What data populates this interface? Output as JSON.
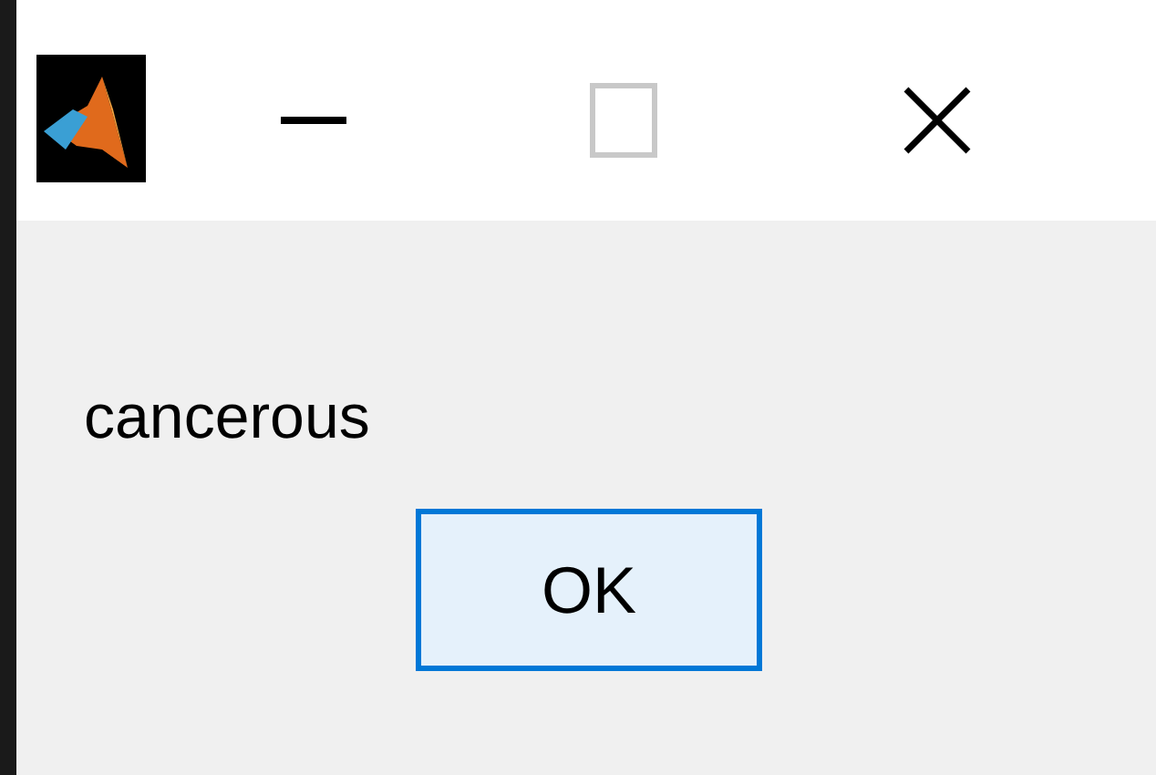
{
  "title_bar": {
    "controls": [
      {
        "kind": "minimize",
        "disabled": false
      },
      {
        "kind": "maximize",
        "disabled": true
      },
      {
        "kind": "close",
        "disabled": false
      }
    ]
  },
  "message": "cancerous",
  "buttons": [
    {
      "label": "OK",
      "focused": true
    }
  ]
}
